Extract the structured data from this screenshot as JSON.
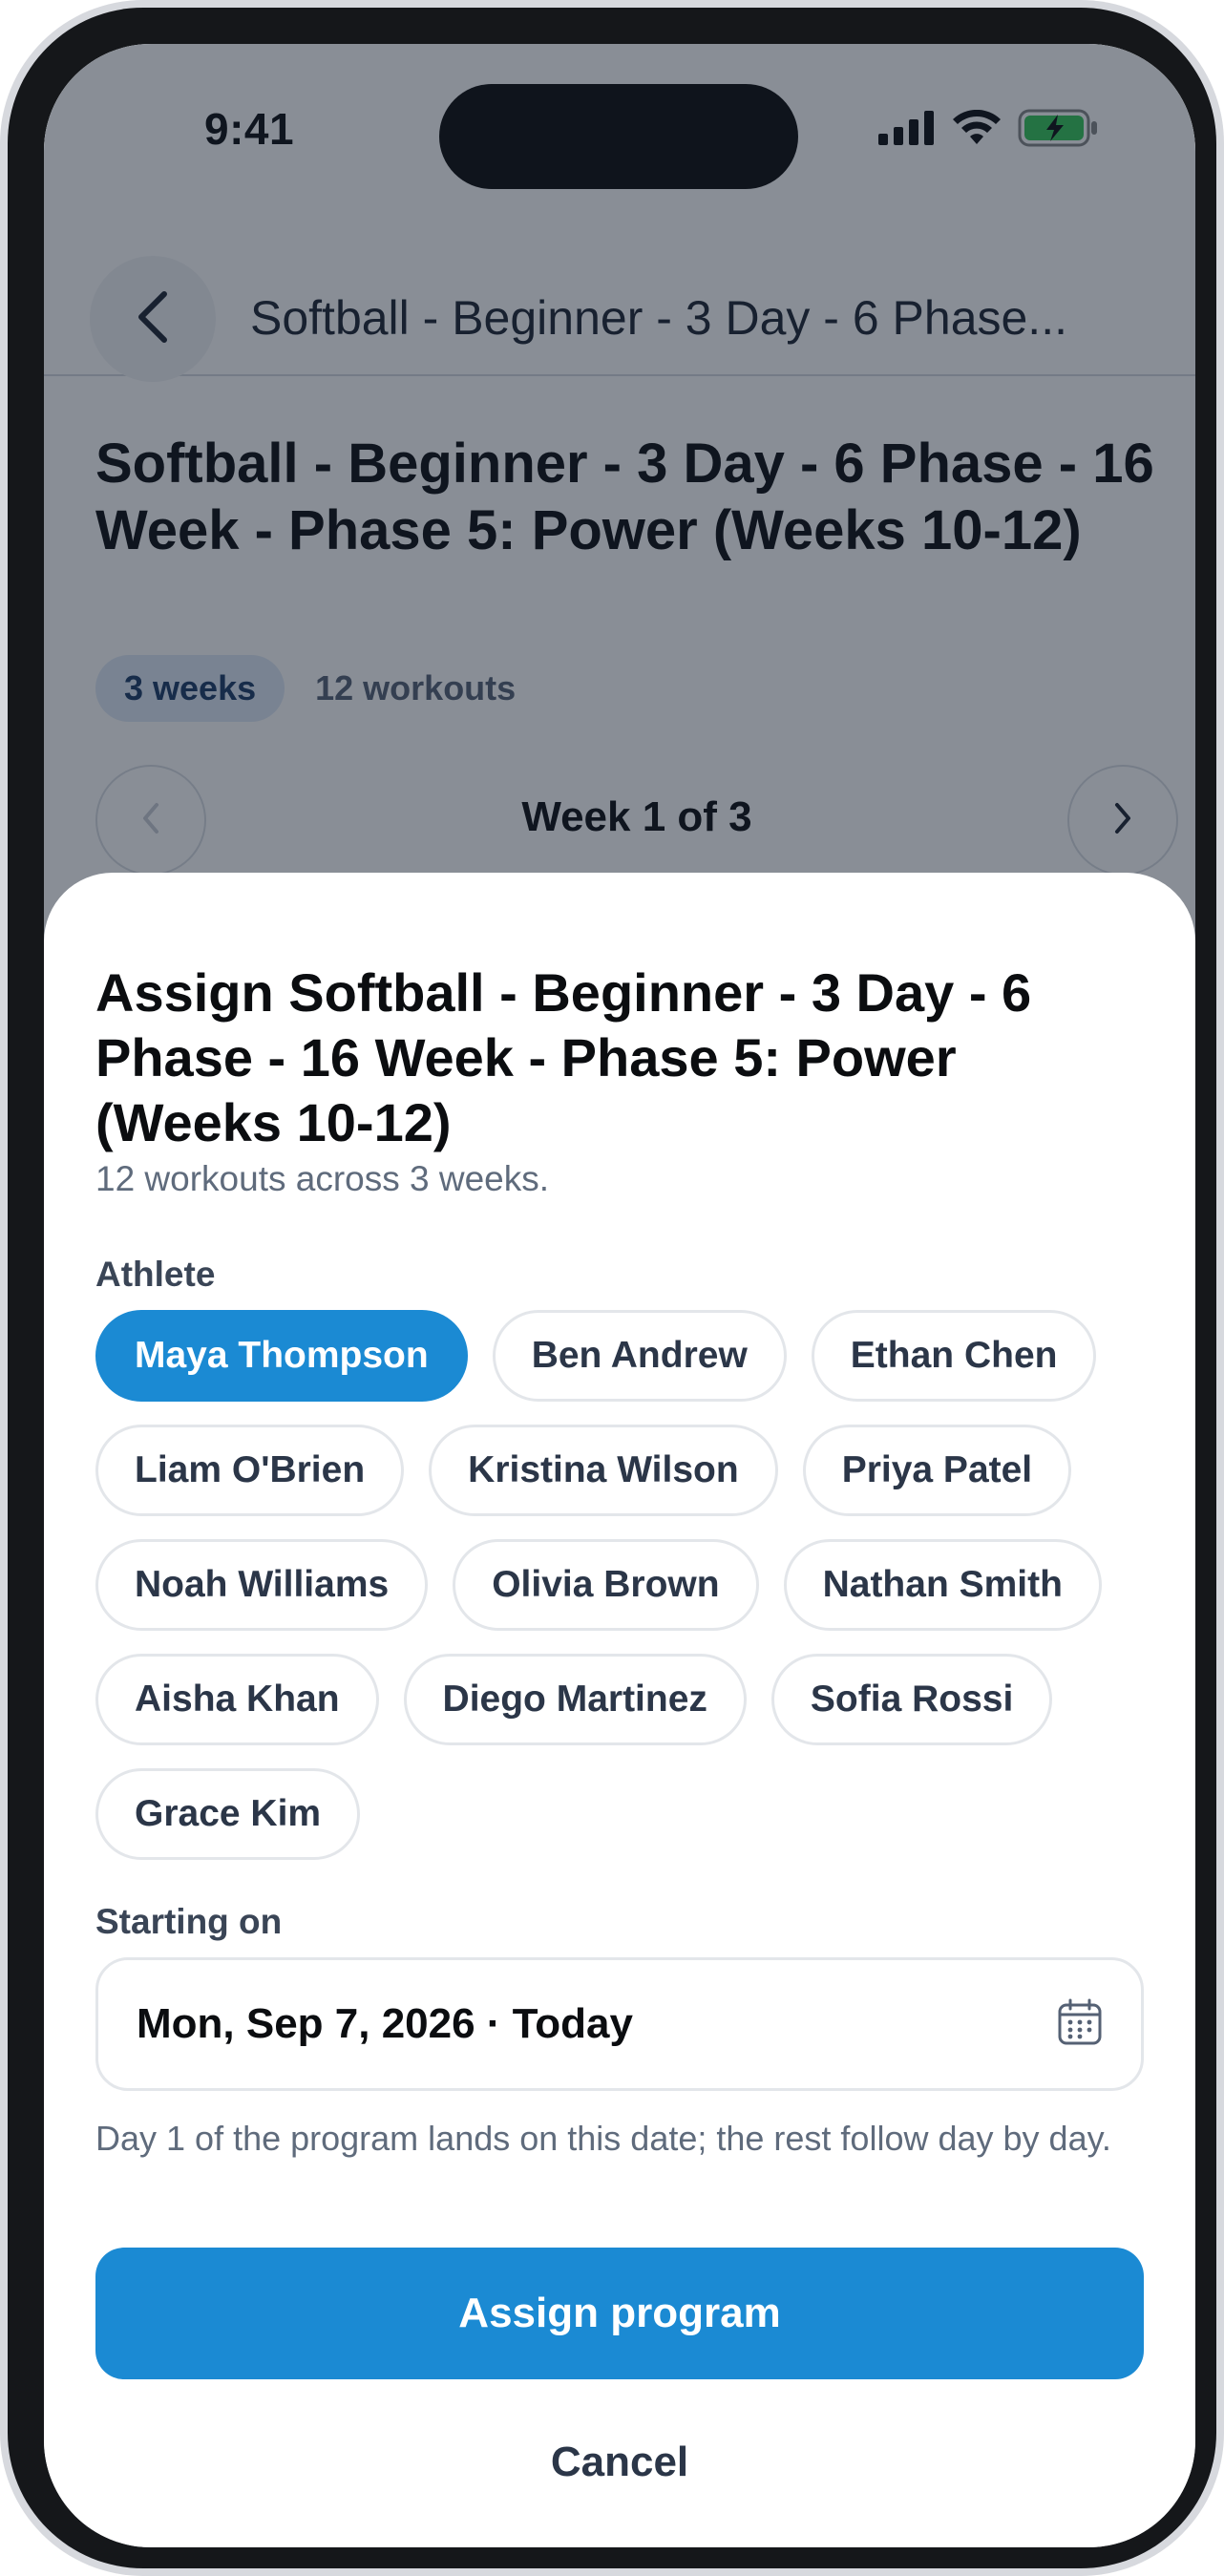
{
  "status_bar": {
    "time": "9:41"
  },
  "nav": {
    "title": "Softball - Beginner - 3 Day - 6 Phase..."
  },
  "program": {
    "title": "Softball - Beginner - 3 Day - 6 Phase - 16 Week - Phase 5:  Power (Weeks 10-12)",
    "weeks_chip": "3 weeks",
    "workouts_chip": "12 workouts",
    "week_label": "Week 1 of 3"
  },
  "sheet": {
    "title": "Assign Softball - Beginner - 3 Day - 6 Phase - 16 Week - Phase 5:  Power (Weeks 10-12)",
    "subtitle": "12 workouts across 3 weeks.",
    "athlete_label": "Athlete",
    "athletes": [
      {
        "name": "Maya Thompson",
        "selected": true
      },
      {
        "name": "Ben Andrew",
        "selected": false
      },
      {
        "name": "Ethan Chen",
        "selected": false
      },
      {
        "name": "Liam O'Brien",
        "selected": false
      },
      {
        "name": "Kristina Wilson",
        "selected": false
      },
      {
        "name": "Priya Patel",
        "selected": false
      },
      {
        "name": "Noah Williams",
        "selected": false
      },
      {
        "name": "Olivia Brown",
        "selected": false
      },
      {
        "name": "Nathan Smith",
        "selected": false
      },
      {
        "name": "Aisha Khan",
        "selected": false
      },
      {
        "name": "Diego Martinez",
        "selected": false
      },
      {
        "name": "Sofia Rossi",
        "selected": false
      },
      {
        "name": "Grace Kim",
        "selected": false
      }
    ],
    "starting_label": "Starting on",
    "date_value": "Mon, Sep 7, 2026 · Today",
    "helper": "Day 1 of the program lands on this date; the rest follow day by day.",
    "assign_label": "Assign program",
    "cancel_label": "Cancel"
  },
  "colors": {
    "accent": "#1b8ad3",
    "battery": "#34c759"
  }
}
